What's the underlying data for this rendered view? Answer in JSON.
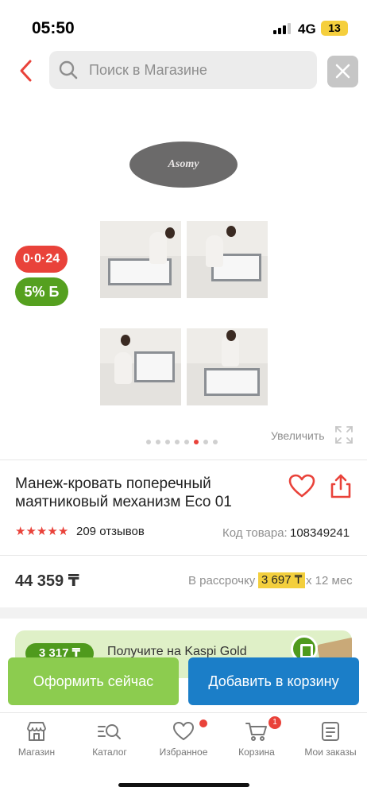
{
  "status_bar": {
    "time": "05:50",
    "network": "4G",
    "battery": "13"
  },
  "search": {
    "placeholder": "Поиск в Магазине"
  },
  "gallery": {
    "brand_logo": "Asomy",
    "timer_badge": "0·0·24",
    "bonus_badge": "5%",
    "bonus_currency": "Б",
    "slides_total": 8,
    "active_slide": 6,
    "zoom_label": "Увеличить"
  },
  "product": {
    "title": "Манеж-кровать поперечный маятниковый механизм Eco 01",
    "rating": 5,
    "reviews": "209 отзывов",
    "code_label": "Код товара:",
    "code_value": "108349241",
    "price": "44 359 ₸",
    "installment_label": "В рассрочку",
    "installment_amount": "3 697 ₸",
    "installment_term": "х 12 мес"
  },
  "promo": {
    "pill": "3 317 ₸",
    "text": "Получите на Kaspi Gold"
  },
  "actions": {
    "checkout": "Оформить сейчас",
    "add_to_cart": "Добавить в корзину"
  },
  "nav": {
    "items": [
      {
        "label": "Магазин",
        "icon": "shop-icon"
      },
      {
        "label": "Каталог",
        "icon": "catalog-search-icon"
      },
      {
        "label": "Избранное",
        "icon": "heart-icon"
      },
      {
        "label": "Корзина",
        "icon": "cart-icon"
      },
      {
        "label": "Мои заказы",
        "icon": "orders-icon"
      }
    ],
    "cart_count": "1"
  },
  "colors": {
    "accent_red": "#e9423a",
    "green": "#55a01f",
    "blue": "#1b7ec8",
    "light_green": "#8ccc4f",
    "yellow": "#f3cf3d"
  }
}
